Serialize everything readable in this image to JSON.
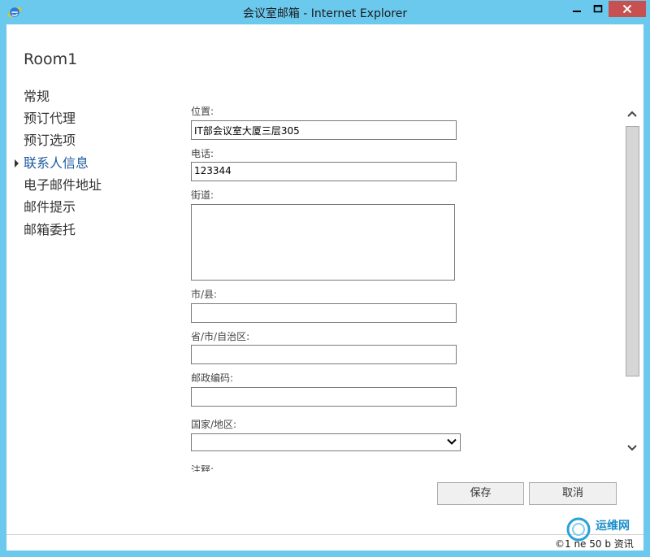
{
  "window": {
    "title": "会议室邮箱 - Internet Explorer",
    "icon": "internet-explorer-icon",
    "controls": [
      "minimize",
      "maximize",
      "close"
    ]
  },
  "room": {
    "title": "Room1"
  },
  "nav": {
    "items": [
      {
        "label": "常规"
      },
      {
        "label": "预订代理"
      },
      {
        "label": "预订选项"
      },
      {
        "label": "联系人信息",
        "active": true
      },
      {
        "label": "电子邮件地址"
      },
      {
        "label": "邮件提示"
      },
      {
        "label": "邮箱委托"
      }
    ]
  },
  "form": {
    "location": {
      "label": "位置:",
      "value": "IT部会议室大厦三层305"
    },
    "phone": {
      "label": "电话:",
      "value": "123344"
    },
    "street": {
      "label": "街道:",
      "value": ""
    },
    "city": {
      "label": "市/县:",
      "value": ""
    },
    "province": {
      "label": "省/市/自治区:",
      "value": ""
    },
    "postal": {
      "label": "邮政编码:",
      "value": ""
    },
    "country": {
      "label": "国家/地区:",
      "value": ""
    },
    "notes": {
      "label": "注释:"
    }
  },
  "buttons": {
    "save": "保存",
    "cancel": "取消"
  },
  "watermark": {
    "title": "运维网",
    "sub": "©1 ne 50 b 资讯"
  },
  "colors": {
    "titlebar": "#6bc9ee",
    "close": "#c75050",
    "active_nav": "#1e5b9e"
  }
}
